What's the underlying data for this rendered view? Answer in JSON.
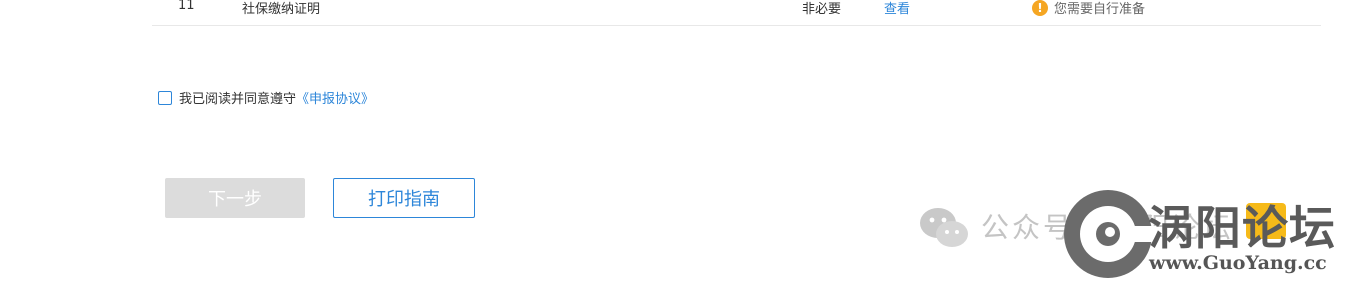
{
  "table_row": {
    "index": "11",
    "name": "社保缴纳证明",
    "required": "非必要",
    "action": "查看",
    "status": "您需要自行准备"
  },
  "agreement": {
    "text": "我已阅读并同意遵守",
    "link": "《申报协议》"
  },
  "buttons": {
    "next": "下一步",
    "print_guide": "打印指南"
  },
  "watermark": {
    "wechat_text": "公众号 · 涡阳论坛",
    "brand": "涡阳论坛",
    "url": "www.GuoYang.cc"
  }
}
